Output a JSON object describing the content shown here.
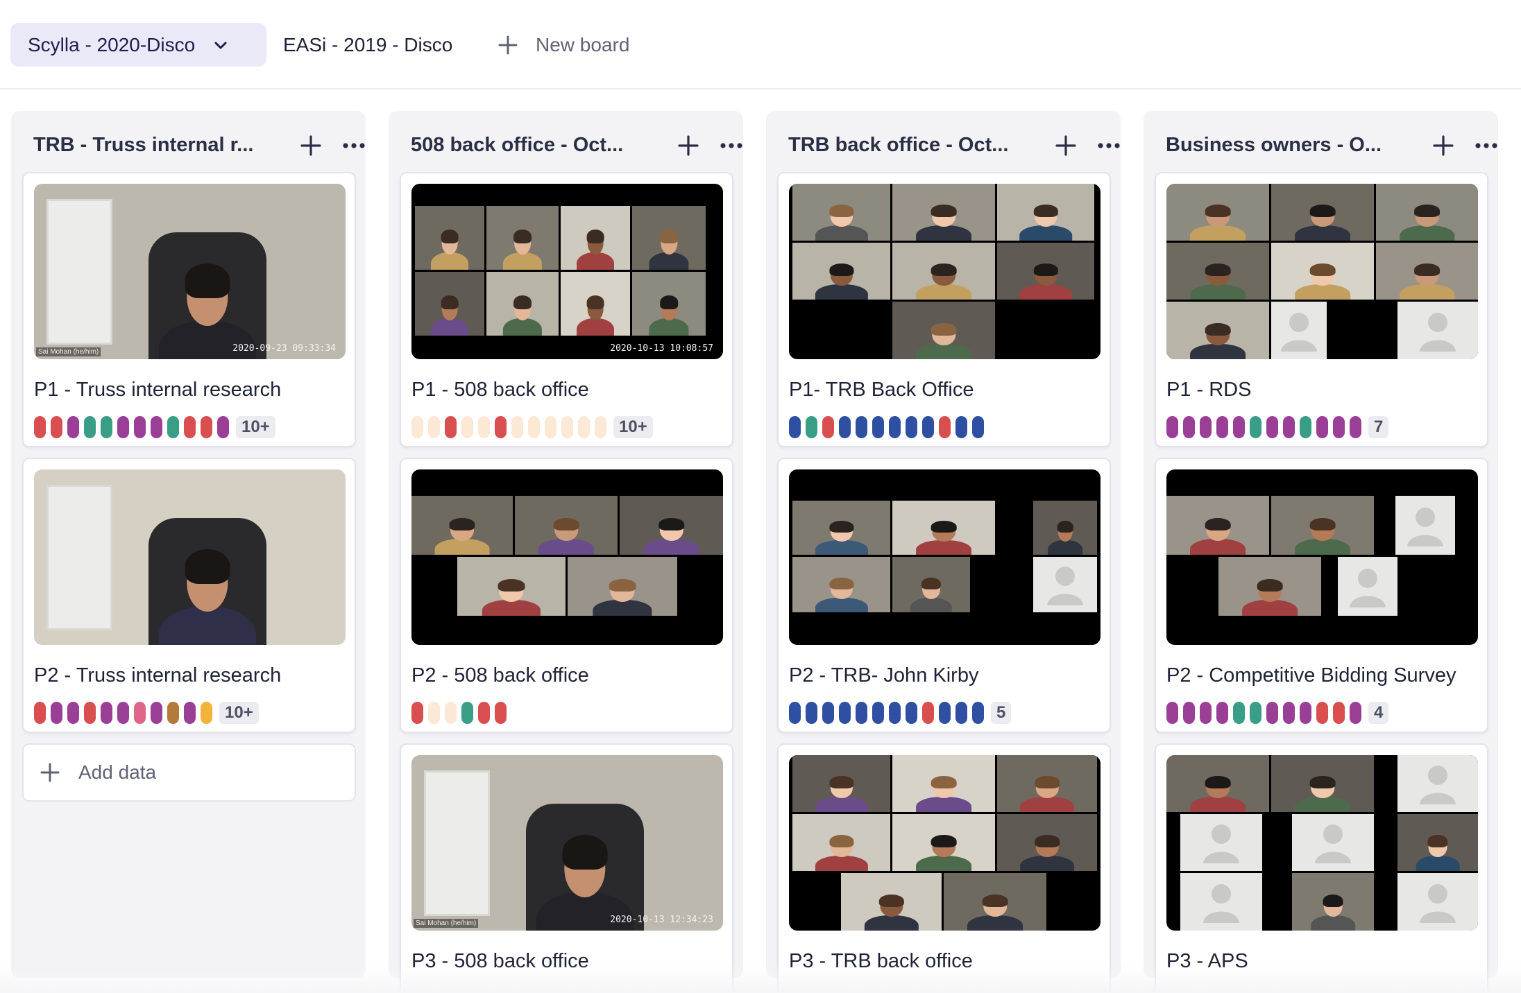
{
  "boards": {
    "active": "Scylla - 2020-Disco",
    "other": "EASi - 2019 - Disco",
    "new_board": "New board"
  },
  "palette": {
    "red": "#d94f4f",
    "purple": "#9b3f96",
    "teal": "#3a9e86",
    "pink": "#e0658a",
    "brown": "#b47a3a",
    "yellow": "#f1b33a",
    "blue": "#2f4fa2",
    "cream": "#fbe9d6"
  },
  "columns": [
    {
      "title": "TRB - Truss internal r...",
      "cards": [
        {
          "title": "P1 - Truss internal research",
          "tags": [
            "red",
            "red",
            "purple",
            "teal",
            "teal",
            "purple",
            "purple",
            "purple",
            "teal",
            "red",
            "red",
            "purple"
          ],
          "badge": "10+",
          "thumb": "single",
          "stamp": "2020-09-23  09:33:34",
          "nametag": "Sai Mohan (he/him)"
        },
        {
          "title": "P2 - Truss internal research",
          "tags": [
            "red",
            "purple",
            "purple",
            "red",
            "purple",
            "purple",
            "pink",
            "purple",
            "brown",
            "purple",
            "yellow"
          ],
          "badge": "10+",
          "thumb": "single-light"
        }
      ],
      "add_label": "Add data"
    },
    {
      "title": "508 back office - Oct...",
      "cards": [
        {
          "title": "P1 - 508 back office",
          "tags": [
            "cream",
            "cream",
            "red",
            "cream",
            "cream",
            "red",
            "cream",
            "cream",
            "cream",
            "cream",
            "cream",
            "cream"
          ],
          "badge": "10+",
          "thumb": "grid6",
          "stamp": "2020-10-13  10:08:57"
        },
        {
          "title": "P2 - 508 back office",
          "tags": [
            "red",
            "cream",
            "cream",
            "teal",
            "red",
            "red"
          ],
          "thumb": "grid5"
        },
        {
          "title": "P3 - 508 back office",
          "thumb": "single",
          "stamp": "2020-10-13  12:34:23",
          "nametag": "Sai Mohan (he/him)"
        }
      ]
    },
    {
      "title": "TRB back office - Oct...",
      "cards": [
        {
          "title": "P1- TRB Back Office",
          "tags": [
            "blue",
            "teal",
            "red",
            "blue",
            "blue",
            "blue",
            "blue",
            "blue",
            "blue",
            "red",
            "blue",
            "blue"
          ],
          "thumb": "grid7"
        },
        {
          "title": "P2 - TRB- John Kirby",
          "tags": [
            "blue",
            "blue",
            "blue",
            "blue",
            "blue",
            "blue",
            "blue",
            "blue",
            "red",
            "blue",
            "blue",
            "blue"
          ],
          "badge": "5",
          "thumb": "grid6b"
        },
        {
          "title": "P3 - TRB back office",
          "thumb": "grid8"
        }
      ]
    },
    {
      "title": "Business owners - O...",
      "cards": [
        {
          "title": "P1 - RDS",
          "tags": [
            "purple",
            "purple",
            "purple",
            "purple",
            "purple",
            "teal",
            "purple",
            "purple",
            "teal",
            "purple",
            "purple",
            "purple"
          ],
          "badge": "7",
          "thumb": "grid9"
        },
        {
          "title": "P2 - Competitive Bidding Survey",
          "tags": [
            "purple",
            "purple",
            "purple",
            "purple",
            "teal",
            "teal",
            "purple",
            "purple",
            "purple",
            "red",
            "red",
            "purple"
          ],
          "badge": "4",
          "thumb": "grid6c"
        },
        {
          "title": "P3 - APS",
          "thumb": "grid9b"
        }
      ]
    }
  ]
}
